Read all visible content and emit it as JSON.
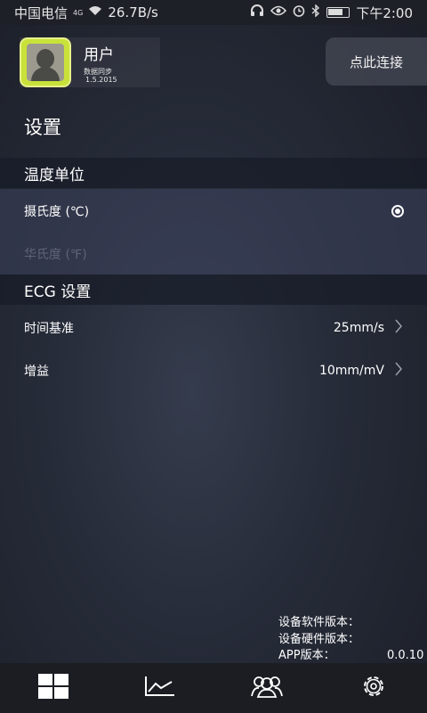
{
  "status_bar": {
    "carrier": "中国电信",
    "network": "4G",
    "speed": "26.7B/s",
    "time": "下午2:00",
    "icons": [
      "headphones-icon",
      "eye-icon",
      "alarm-icon",
      "bluetooth-icon",
      "battery-icon"
    ]
  },
  "user": {
    "name": "用户",
    "sync_label": "数据同步",
    "sync_date": "1.5.2015",
    "avatar_color": "#c8e23a"
  },
  "connect_button": "点此连接",
  "page_title": "设置",
  "temperature": {
    "header": "温度单位",
    "options": [
      {
        "label": "摄氏度 (℃)",
        "selected": true
      },
      {
        "label": "华氏度 (℉)",
        "selected": false
      }
    ]
  },
  "ecg": {
    "header": "ECG 设置",
    "rows": [
      {
        "label": "时间基准",
        "value": "25mm/s"
      },
      {
        "label": "增益",
        "value": "10mm/mV"
      }
    ]
  },
  "version": {
    "software_label": "设备软件版本：",
    "hardware_label": "设备硬件版本：",
    "app_label": "APP版本：",
    "app_value": "0.0.10"
  },
  "tabs": [
    {
      "name": "dashboard-tab",
      "icon": "grid-icon"
    },
    {
      "name": "chart-tab",
      "icon": "line-chart-icon"
    },
    {
      "name": "group-tab",
      "icon": "users-icon"
    },
    {
      "name": "settings-tab",
      "icon": "gear-icon"
    }
  ]
}
